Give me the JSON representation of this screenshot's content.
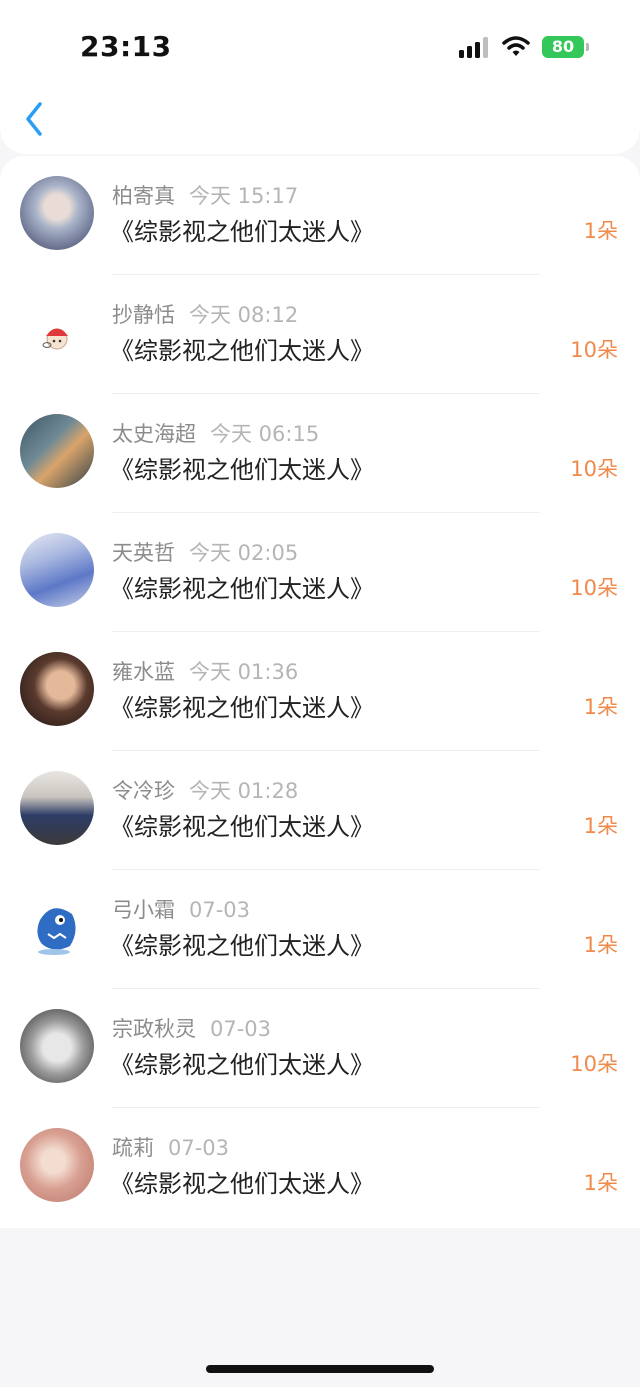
{
  "status_bar": {
    "time": "23:13",
    "battery": "80"
  },
  "colors": {
    "accent": "#2a9df4",
    "amount": "#f08a4b",
    "battery": "#34c759"
  },
  "header": {
    "back_icon": "chevron-left-icon"
  },
  "list": [
    {
      "name": "柏寄真",
      "time": "今天 15:17",
      "title": "《综影视之他们太迷人》",
      "amount": "1朵"
    },
    {
      "name": "抄静恬",
      "time": "今天 08:12",
      "title": "《综影视之他们太迷人》",
      "amount": "10朵"
    },
    {
      "name": "太史海超",
      "time": "今天 06:15",
      "title": "《综影视之他们太迷人》",
      "amount": "10朵"
    },
    {
      "name": "天英哲",
      "time": "今天 02:05",
      "title": "《综影视之他们太迷人》",
      "amount": "10朵"
    },
    {
      "name": "雍水蓝",
      "time": "今天 01:36",
      "title": "《综影视之他们太迷人》",
      "amount": "1朵"
    },
    {
      "name": "令冷珍",
      "time": "今天 01:28",
      "title": "《综影视之他们太迷人》",
      "amount": "1朵"
    },
    {
      "name": "弓小霜",
      "time": "07-03",
      "title": "《综影视之他们太迷人》",
      "amount": "1朵"
    },
    {
      "name": "宗政秋灵",
      "time": "07-03",
      "title": "《综影视之他们太迷人》",
      "amount": "10朵"
    },
    {
      "name": "疏莉",
      "time": "07-03",
      "title": "《综影视之他们太迷人》",
      "amount": "1朵"
    }
  ]
}
